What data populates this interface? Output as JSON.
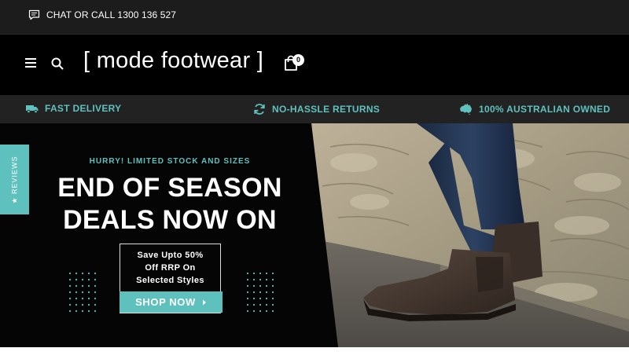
{
  "topbar": {
    "chat_label": "CHAT OR CALL 1300 136 527",
    "chat_icon": "chat-bubble-icon"
  },
  "header": {
    "logo": "[ mode footwear ]",
    "cart_count": "0",
    "icons": [
      "menu-icon",
      "search-icon",
      "cart-icon"
    ]
  },
  "features": [
    {
      "label": "FAST DELIVERY",
      "icon": "truck-icon"
    },
    {
      "label": "NO-HASSLE RETURNS",
      "icon": "refresh-icon"
    },
    {
      "label": "100% AUSTRALIAN OWNED",
      "icon": "australia-icon"
    }
  ],
  "hero": {
    "eyebrow": "HURRY! LIMITED STOCK AND SIZES",
    "headline_line1": "END OF SEASON",
    "headline_line2": "DEALS NOW ON",
    "save_text": "Save Upto 50%\nOff RRP On\nSelected Styles",
    "cta_label": "SHOP NOW",
    "cta_icon": "caret-right-icon"
  },
  "reviews_tab": {
    "label": "★ REVIEWS"
  },
  "colors": {
    "accent": "#5fc1be",
    "background": "#000000",
    "topbar": "#1c1c1c",
    "feature_bar": "#222222"
  }
}
